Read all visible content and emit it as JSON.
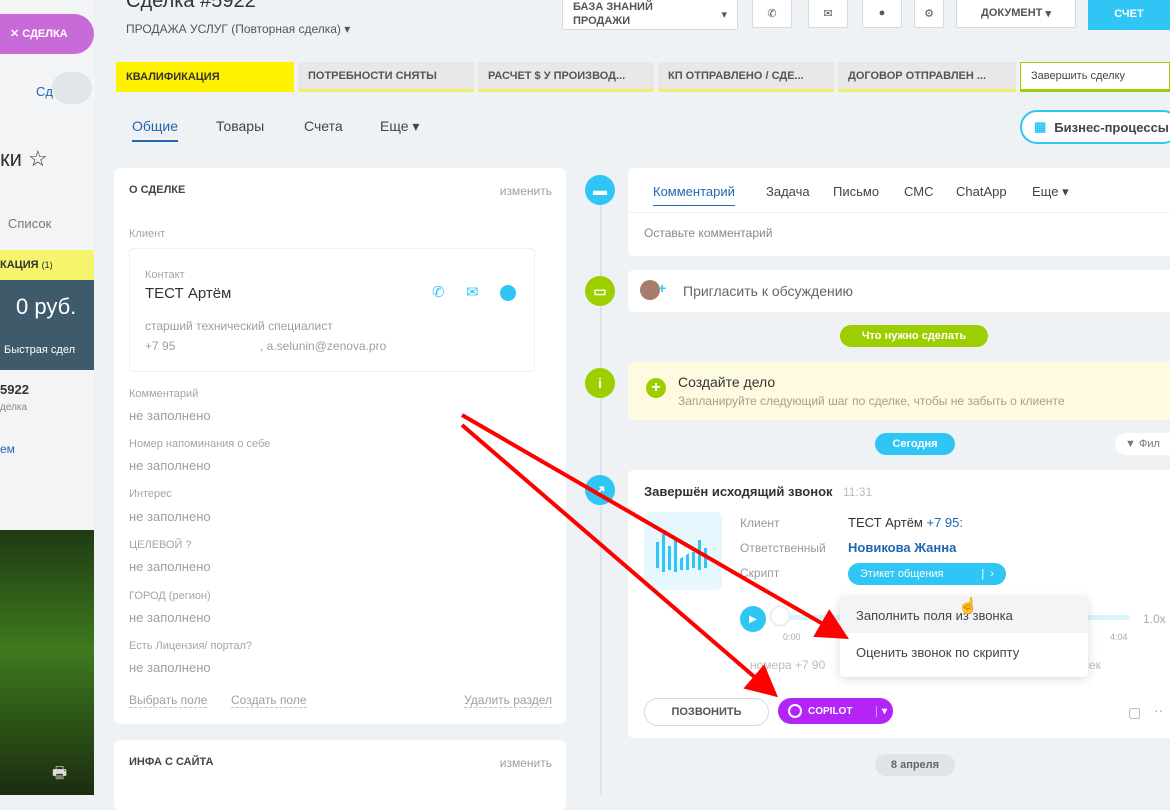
{
  "left_panel": {
    "top_label": "СДЕЛКА",
    "tab_label": "Сд",
    "title_partial": "ки",
    "list_label": "Список",
    "stage_label": "КАЦИЯ",
    "stage_count": "(1)",
    "amount": "0 руб.",
    "quick_deal": "Быстрая сдел",
    "deal_number": "5922",
    "deal_sub": "делка",
    "link_text": "ем"
  },
  "header": {
    "title": "Сделка #5922",
    "subtitle": "ПРОДАЖА УСЛУГ (Повторная сделка)",
    "knowledge_base_line1": "БАЗА ЗНАНИЙ",
    "knowledge_base_line2": "ПРОДАЖИ",
    "document_label": "ДОКУМЕНТ",
    "invoice_label": "СЧЕТ"
  },
  "stages": [
    {
      "label": "КВАЛИФИКАЦИЯ",
      "state": "active"
    },
    {
      "label": "ПОТРЕБНОСТИ СНЯТЫ",
      "state": "pending"
    },
    {
      "label": "РАСЧЕТ $ У ПРОИЗВОД...",
      "state": "pending"
    },
    {
      "label": "КП ОТПРАВЛЕНО / СДЕ...",
      "state": "pending"
    },
    {
      "label": "ДОГОВОР ОТПРАВЛЕН ...",
      "state": "pending"
    },
    {
      "label": "Завершить сделку",
      "state": "finish"
    }
  ],
  "tabs": [
    "Общие",
    "Товары",
    "Счета",
    "Еще"
  ],
  "business_process": "Бизнес-процессы",
  "about": {
    "heading": "О СДЕЛКЕ",
    "edit": "изменить",
    "client_label": "Клиент",
    "contact_label": "Контакт",
    "contact_name": "ТЕСТ Артём",
    "contact_position": "старший технический специалист",
    "contact_phone": "+7 95",
    "contact_email": "a.selunin@zenova.pro",
    "fields": [
      {
        "label": "Комментарий",
        "value": "не заполнено"
      },
      {
        "label": "Номер напоминания о себе",
        "value": "не заполнено"
      },
      {
        "label": "Интерес",
        "value": "не заполнено"
      },
      {
        "label": "ЦЕЛЕВОЙ ?",
        "value": "не заполнено"
      },
      {
        "label": "ГОРОД (регион)",
        "value": "не заполнено"
      },
      {
        "label": "Есть Лицензия/ портал?",
        "value": "не заполнено"
      }
    ],
    "select_field": "Выбрать поле",
    "create_field": "Создать поле",
    "delete_section": "Удалить раздел"
  },
  "site_info": {
    "heading": "ИНФА С САЙТА",
    "edit": "изменить"
  },
  "timeline": {
    "editor_tabs": [
      "Комментарий",
      "Задача",
      "Письмо",
      "СМС",
      "ChatApp",
      "Еще"
    ],
    "comment_placeholder": "Оставьте комментарий",
    "invite": "Пригласить к обсуждению",
    "todo_badge": "Что нужно сделать",
    "create_task_title": "Создайте дело",
    "create_task_sub": "Запланируйте следующий шаг по сделке, чтобы не забыть о клиенте",
    "today_badge": "Сегодня",
    "filter_label": "Фил",
    "call": {
      "title": "Завершён исходящий звонок",
      "time": "11:31",
      "client_label": "Клиент",
      "client_name": "ТЕСТ Артём",
      "client_phone": "+7 95:",
      "responsible_label": "Ответственный",
      "responsible_name": "Новикова Жанна",
      "script_label": "Скрипт",
      "script_value": "Этикет общения",
      "time_start": "0:00",
      "time_end": "4:04",
      "speed": "1.0x",
      "number_label": "номера +7 90",
      "number_tail": "сек",
      "call_button": "ПОЗВОНИТЬ",
      "copilot_button": "COPILOT"
    },
    "menu": [
      "Заполнить поля из звонка",
      "Оценить звонок по скрипту"
    ],
    "date_badge": "8 апреля"
  },
  "colors": {
    "accent_blue": "#2fc6f6",
    "stage_yellow": "#fff200",
    "todo_green": "#9dcf00",
    "copilot_purple": "#b325f7",
    "arrow_red": "#ff0000",
    "link_blue": "#2067b0"
  }
}
